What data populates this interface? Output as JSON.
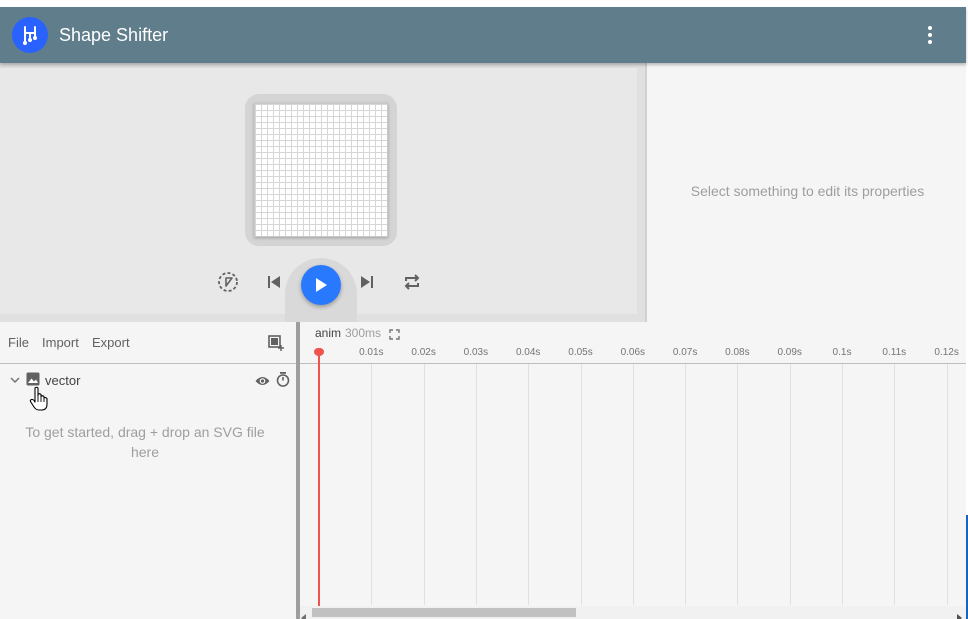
{
  "toolbar": {
    "title": "Shape Shifter",
    "logo_icon": "shape-shifter-logo-icon",
    "menu_icon": "more-vert-icon",
    "color": "#607d8b",
    "logo_color": "#2962ff"
  },
  "canvas": {
    "playback": {
      "speed_icon": "slow-motion-icon",
      "skip_previous_icon": "skip-previous-icon",
      "play_icon": "play-icon",
      "skip_next_icon": "skip-next-icon",
      "repeat_icon": "repeat-icon",
      "play_color": "#2979ff"
    }
  },
  "properties": {
    "empty_text": "Select something to edit its properties"
  },
  "layers": {
    "file_label": "File",
    "import_label": "Import",
    "export_label": "Export",
    "add_layer_icon": "add-layer-icon",
    "items": [
      {
        "name": "vector",
        "icon": "image-icon",
        "expanded": true
      }
    ],
    "drop_hint": "To get started, drag + drop an SVG file here"
  },
  "timeline": {
    "animation_name": "anim",
    "duration": "300ms",
    "ticks": [
      "0.01s",
      "0.02s",
      "0.03s",
      "0.04s",
      "0.05s",
      "0.06s",
      "0.07s",
      "0.08s",
      "0.09s",
      "0.1s",
      "0.11s",
      "0.12s"
    ],
    "current_time": "0s",
    "playhead_color": "#ef5350"
  }
}
